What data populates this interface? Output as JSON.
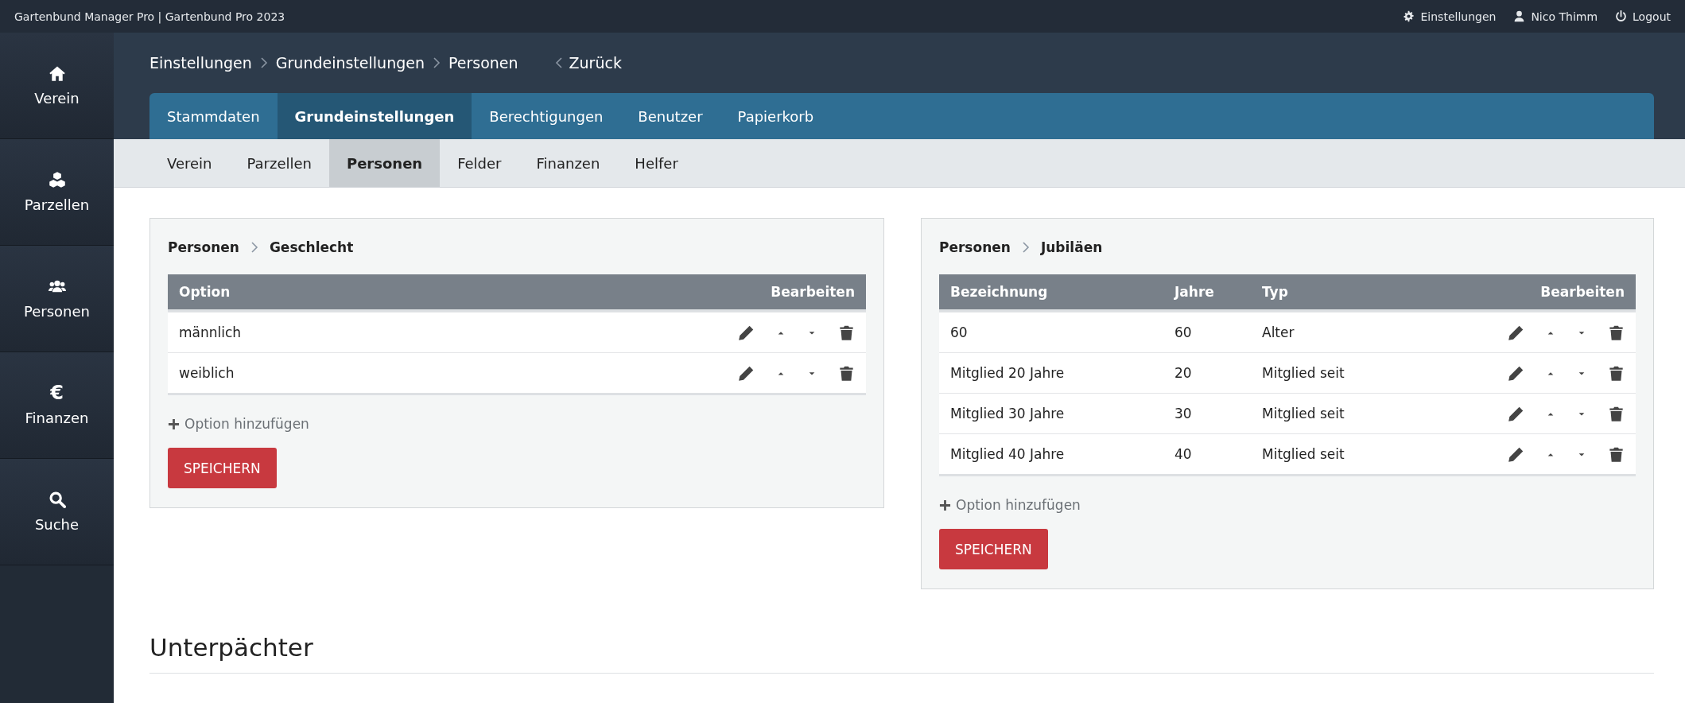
{
  "top_bar": {
    "title": "Gartenbund Manager Pro | Gartenbund Pro 2023",
    "links": [
      {
        "label": "Einstellungen"
      },
      {
        "label": "Nico Thimm"
      },
      {
        "label": "Logout"
      }
    ]
  },
  "sidebar": {
    "items": [
      {
        "label": "Verein",
        "selected": false
      },
      {
        "label": "Parzellen",
        "selected": false
      },
      {
        "label": "Personen",
        "selected": false
      },
      {
        "glyph": "€",
        "label": "Finanzen",
        "selected": false
      },
      {
        "label": "Suche",
        "selected": false
      }
    ]
  },
  "breadcrumb": {
    "items": [
      "Einstellungen",
      "Grundeinstellungen",
      "Personen"
    ],
    "back": "Zurück"
  },
  "tabs": [
    {
      "label": "Stammdaten",
      "selected": false
    },
    {
      "label": "Grundeinstellungen",
      "selected": true
    },
    {
      "label": "Berechtigungen",
      "selected": false
    },
    {
      "label": "Benutzer",
      "selected": false
    },
    {
      "label": "Papierkorb",
      "selected": false
    }
  ],
  "subtabs": [
    {
      "label": "Verein",
      "selected": false
    },
    {
      "label": "Parzellen",
      "selected": false
    },
    {
      "label": "Personen",
      "selected": true
    },
    {
      "label": "Felder",
      "selected": false
    },
    {
      "label": "Finanzen",
      "selected": false
    },
    {
      "label": "Helfer",
      "selected": false
    }
  ],
  "panels": [
    {
      "path": [
        "Personen",
        "Geschlecht"
      ],
      "table": {
        "columns": [
          "Option"
        ],
        "actions_heading": "Bearbeiten",
        "rows": [
          [
            "männlich"
          ],
          [
            "weiblich"
          ]
        ]
      },
      "add_link": "Option hinzufügen",
      "save_button": "SPEICHERN"
    },
    {
      "path": [
        "Personen",
        "Jubiläen"
      ],
      "table": {
        "columns": [
          "Bezeichnung",
          "Jahre",
          "Typ"
        ],
        "actions_heading": "Bearbeiten",
        "rows": [
          [
            "60",
            "60",
            "Alter"
          ],
          [
            "Mitglied 20 Jahre",
            "20",
            "Mitglied seit"
          ],
          [
            "Mitglied 30 Jahre",
            "30",
            "Mitglied seit"
          ],
          [
            "Mitglied 40 Jahre",
            "40",
            "Mitglied seit"
          ]
        ]
      },
      "add_link": "Option hinzufügen",
      "save_button": "SPEICHERN"
    }
  ],
  "section_heading": "Unterpächter"
}
